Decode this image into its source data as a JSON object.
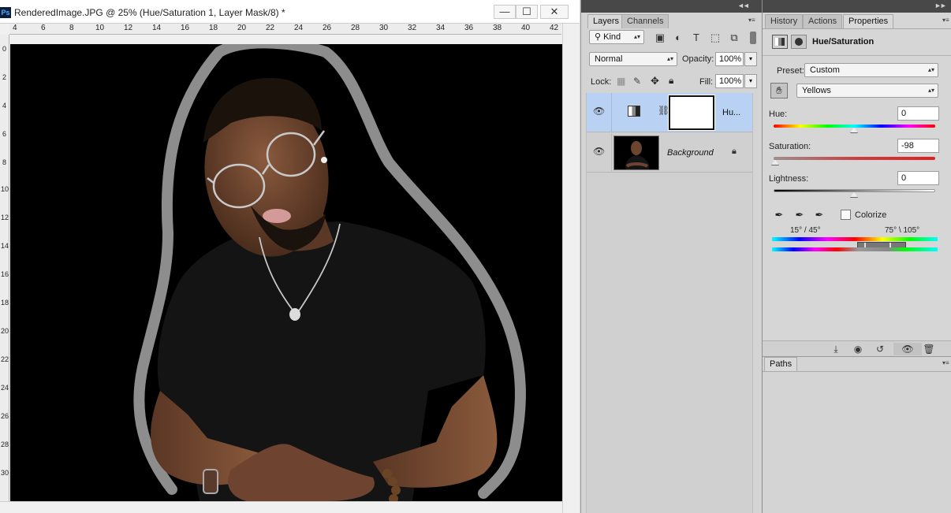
{
  "app": {
    "logo": "Ps"
  },
  "document": {
    "title": "RenderedImage.JPG @ 25% (Hue/Saturation 1, Layer Mask/8) *",
    "window_controls": {
      "minimize": "—",
      "maximize": "☐",
      "close": "✕"
    },
    "ruler_top": [
      "4",
      "6",
      "8",
      "10",
      "12",
      "14",
      "16",
      "18",
      "20",
      "22",
      "24",
      "26",
      "28",
      "30",
      "32",
      "34",
      "36",
      "38",
      "40",
      "42"
    ],
    "ruler_left": [
      "0",
      "2",
      "4",
      "6",
      "8",
      "10",
      "12",
      "14",
      "16",
      "18",
      "20",
      "22",
      "24",
      "26",
      "28",
      "30"
    ]
  },
  "layers_panel": {
    "tabs": [
      {
        "label": "Layers",
        "active": true
      },
      {
        "label": "Channels",
        "active": false
      }
    ],
    "filter": {
      "label": "Kind",
      "icons": [
        "image-filter-icon",
        "adjustment-filter-icon",
        "type-filter-icon",
        "shape-filter-icon",
        "smart-object-filter-icon"
      ]
    },
    "blend_mode": "Normal",
    "opacity_label": "Opacity:",
    "opacity_value": "100%",
    "lock_label": "Lock:",
    "fill_label": "Fill:",
    "fill_value": "100%",
    "layers": [
      {
        "name": "Hu...",
        "type": "adjustment",
        "selected": true,
        "visible": true
      },
      {
        "name": "Background",
        "type": "image",
        "selected": false,
        "visible": true,
        "locked": true
      }
    ]
  },
  "properties_panel": {
    "tabs": [
      {
        "label": "History",
        "active": false
      },
      {
        "label": "Actions",
        "active": false
      },
      {
        "label": "Properties",
        "active": true
      }
    ],
    "title": "Hue/Saturation",
    "preset_label": "Preset:",
    "preset_value": "Custom",
    "channel_value": "Yellows",
    "hue_label": "Hue:",
    "hue_value": "0",
    "saturation_label": "Saturation:",
    "saturation_value": "-98",
    "lightness_label": "Lightness:",
    "lightness_value": "0",
    "colorize_label": "Colorize",
    "colorize_checked": false,
    "range_left": "15° / 45°",
    "range_right": "75° \\ 105°"
  },
  "paths_panel": {
    "tab": "Paths"
  }
}
